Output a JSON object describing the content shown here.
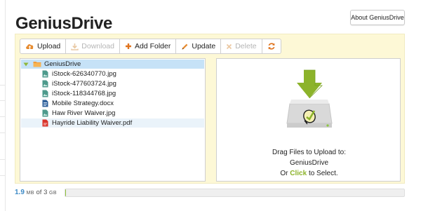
{
  "app": {
    "title": "GeniusDrive",
    "about_label": "About GeniusDrive"
  },
  "toolbar": {
    "upload": "Upload",
    "download": "Download",
    "add_folder": "Add Folder",
    "update": "Update",
    "delete": "Delete"
  },
  "tree": {
    "root": "GeniusDrive",
    "files": [
      {
        "name": "iStock-626340770.jpg",
        "type": "image"
      },
      {
        "name": "iStock-477603724.jpg",
        "type": "image"
      },
      {
        "name": "iStock-118344768.jpg",
        "type": "image"
      },
      {
        "name": "Mobile Strategy.docx",
        "type": "doc"
      },
      {
        "name": "Haw River Waiver.jpg",
        "type": "image"
      },
      {
        "name": "Hayride Liability Waiver.pdf",
        "type": "pdf",
        "selected": true
      }
    ]
  },
  "dropzone": {
    "line1": "Drag Files to Upload to:",
    "target": "GeniusDrive",
    "or": "Or",
    "click": "Click",
    "to_select": "to Select."
  },
  "storage": {
    "used": "1.9",
    "used_unit": "MB",
    "of": "of",
    "total": "3",
    "total_unit": "GB",
    "used_fraction": 0.0006
  },
  "colors": {
    "accent_green": "#8cb32a",
    "tree_selected": "#c6e2f7",
    "panel_bg": "#fdf8d6",
    "storage_blue": "#3d8ac6"
  }
}
